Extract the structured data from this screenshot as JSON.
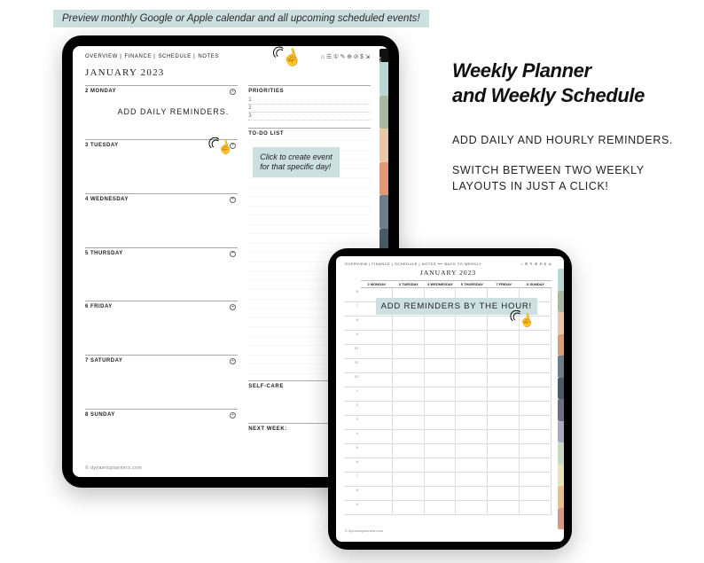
{
  "banner": "Preview monthly Google or Apple calendar and all upcoming scheduled events!",
  "headline": {
    "title_l1": "Weekly Planner",
    "title_l2": "and Weekly Schedule",
    "sub1": "ADD DAILY AND HOURLY REMINDERS.",
    "sub2": "SWITCH BETWEEN TWO WEEKLY LAYOUTS IN JUST A CLICK!"
  },
  "tab_colors": [
    "#bcd6d3",
    "#a8b8a1",
    "#e8c7a8",
    "#dd9b7a",
    "#6e7e8a",
    "#4c5b66",
    "#6e6e85",
    "#a8a8c0",
    "#c9d8c2",
    "#e8e2b8",
    "#e6c08e",
    "#d39b84"
  ],
  "large": {
    "nav_tabs": [
      "OVERVIEW",
      "FINANCE",
      "SCHEDULE",
      "NOTES"
    ],
    "nav_icons": [
      "⌂",
      "☰",
      "①",
      "✎",
      "⊕",
      "⊘",
      "$",
      "⇲"
    ],
    "index_label": "INDEX",
    "title": "JANUARY 2023",
    "days": [
      {
        "n": "2",
        "name": "MONDAY"
      },
      {
        "n": "3",
        "name": "TUESDAY"
      },
      {
        "n": "4",
        "name": "WEDNESDAY"
      },
      {
        "n": "5",
        "name": "THURSDAY"
      },
      {
        "n": "6",
        "name": "FRIDAY"
      },
      {
        "n": "7",
        "name": "SATURDAY"
      },
      {
        "n": "8",
        "name": "SUNDAY"
      }
    ],
    "monday_note": "ADD DAILY REMINDERS.",
    "tuesday_callout": "Click to create event for that specific day!",
    "right_sections": {
      "priorities": "PRIORITIES",
      "priorities_items": [
        "1",
        "2",
        "3"
      ],
      "todo": "TO-DO LIST",
      "selfcare": "SELF-CARE",
      "nextweek": "NEXT WEEK:"
    },
    "footer": "© dynamicplanners.com"
  },
  "small": {
    "nav_left": "OVERVIEW | FINANCE | SCHEDULE | NOTES  ⟵ BACK TO WEEKLY",
    "nav_icons": "⌂ ☰ ✎ ⊕ ⊘ $ ⇲",
    "title": "JANUARY 2023",
    "days": [
      {
        "n": "2",
        "name": "MONDAY"
      },
      {
        "n": "3",
        "name": "TUESDAY"
      },
      {
        "n": "4",
        "name": "WEDNESDAY"
      },
      {
        "n": "5",
        "name": "THURSDAY"
      },
      {
        "n": "7",
        "name": "FRIDAY"
      },
      {
        "n": "8",
        "name": "SUNDAY"
      }
    ],
    "hours": [
      "6",
      "7",
      "8",
      "9",
      "10",
      "11",
      "12",
      "1",
      "2",
      "3",
      "4",
      "5",
      "6",
      "7",
      "8",
      "9"
    ],
    "callout": "ADD REMINDERS BY THE HOUR!",
    "footer": "© dynamicplanners.com"
  }
}
